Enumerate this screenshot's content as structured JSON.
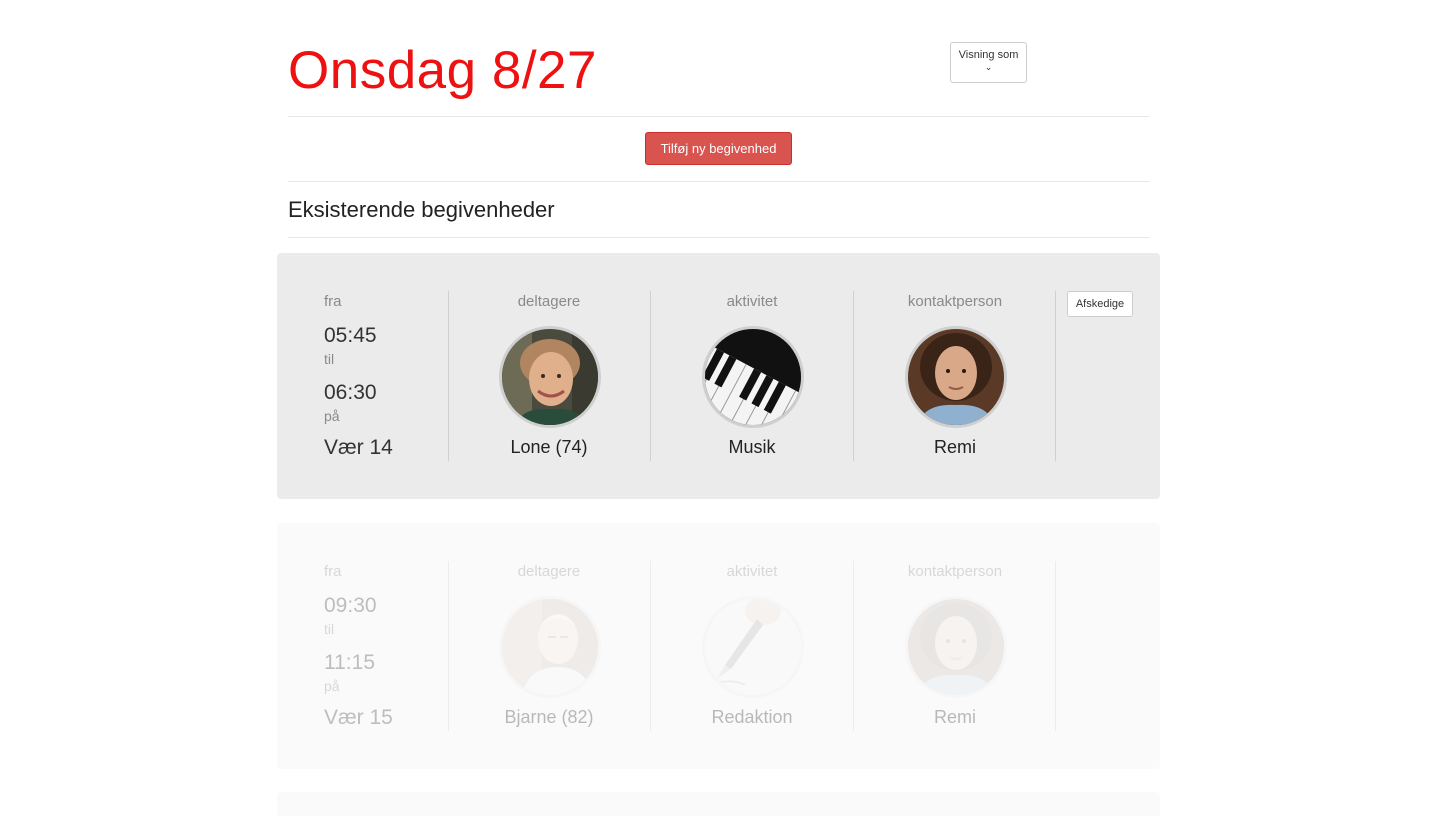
{
  "header": {
    "title": "Onsdag 8/27",
    "view_as_label": "Visning som",
    "view_as_caret": "⌄"
  },
  "actions": {
    "add_event_label": "Tilføj ny begivenhed"
  },
  "section": {
    "title": "Eksisterende begivenheder"
  },
  "labels": {
    "from": "fra",
    "to": "til",
    "at": "på",
    "participants": "deltagere",
    "activity": "aktivitet",
    "contact": "kontaktperson",
    "dismiss": "Afskedige"
  },
  "events": [
    {
      "from_time": "05:45",
      "to_time": "06:30",
      "room": "Vær 14",
      "participant": "Lone (74)",
      "participant_icon": "woman-portrait",
      "activity": "Musik",
      "activity_icon": "piano-keys",
      "contact": "Remi",
      "contact_icon": "woman-portrait"
    },
    {
      "from_time": "09:30",
      "to_time": "11:15",
      "room": "Vær 15",
      "participant": "Bjarne (82)",
      "participant_icon": "man-portrait",
      "activity": "Redaktion",
      "activity_icon": "fountain-pen",
      "contact": "Remi",
      "contact_icon": "woman-portrait"
    }
  ],
  "colors": {
    "title": "#ee1111",
    "primary_button": "#d9534f",
    "card_active": "#ebebeb",
    "card_faded": "#fafafa"
  }
}
